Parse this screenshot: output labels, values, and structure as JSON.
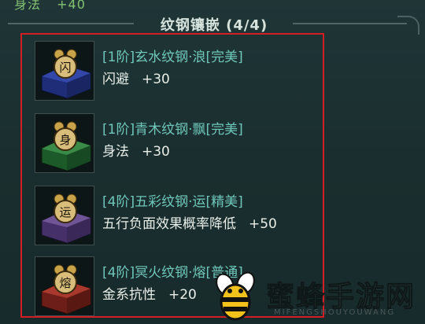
{
  "header": {
    "top_stat_label": "身法",
    "top_stat_value": "+40",
    "title": "纹钢镶嵌 (4/4)"
  },
  "gems": [
    {
      "glyph": "闪",
      "name": "[1阶]玄水纹钢·浪[完美]",
      "stat": "闪避",
      "value": "+30",
      "icon_color": "#2b3c9a"
    },
    {
      "glyph": "身",
      "name": "[1阶]青木纹钢·飘[完美]",
      "stat": "身法",
      "value": "+30",
      "icon_color": "#2e7a3c"
    },
    {
      "glyph": "运",
      "name": "[4阶]五彩纹钢·运[精美]",
      "stat": "五行负面效果概率降低",
      "value": "+50",
      "icon_color": "#5b3f7e"
    },
    {
      "glyph": "熔",
      "name": "[4阶]冥火纹钢·熔[普通]",
      "stat": "金系抗性",
      "value": "+20",
      "icon_color": "#8a2a22"
    }
  ],
  "watermark": {
    "text": "蜜蜂手游网",
    "sub": "MIFENGSHOUYOUWANG"
  },
  "colors": {
    "frame": "#d21e24",
    "gem_name": "#6fc7b9",
    "stat_text": "#e8eee8"
  }
}
